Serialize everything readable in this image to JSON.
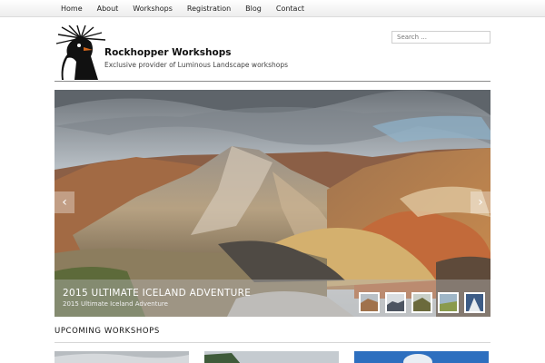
{
  "nav": {
    "items": [
      "Home",
      "About",
      "Workshops",
      "Registration",
      "Blog",
      "Contact"
    ]
  },
  "header": {
    "title": "Rockhopper Workshops",
    "tagline": "Exclusive provider of Luminous Landscape workshops",
    "logo_icon": "rockhopper-penguin-logo"
  },
  "search": {
    "placeholder": "Search ..."
  },
  "slider": {
    "caption_title": "2015 ULTIMATE ICELAND ADVENTURE",
    "caption_subtitle": "2015 Ultimate Iceland Adventure",
    "prev_icon": "chevron-left-icon",
    "next_icon": "chevron-right-icon",
    "thumbnail_count": 5
  },
  "upcoming": {
    "heading": "UPCOMING WORKSHOPS",
    "card_count": 3
  },
  "colors": {
    "nav_bg": "#ededed",
    "header_rule": "#8a8a8a",
    "caption_bar": "#b4b4b4"
  }
}
